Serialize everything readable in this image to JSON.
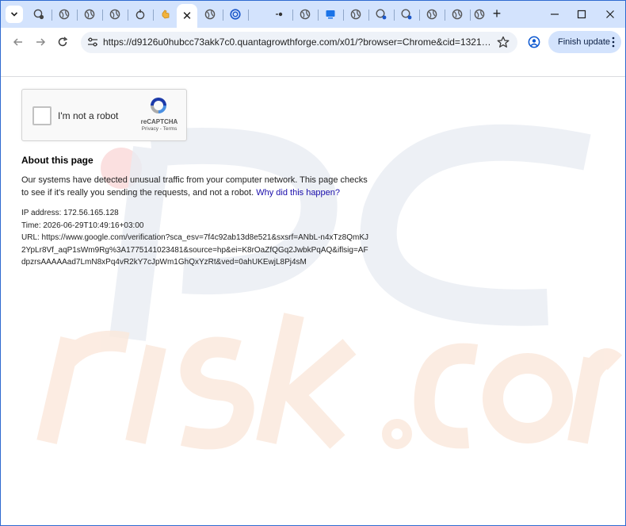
{
  "browser": {
    "tab_count_pinned": 21,
    "active_tab_close": "✕",
    "new_tab_label": "+",
    "address_url": "https://d9126u0hubcc73akk7c0.quantagrowthforge.com/x01/?browser=Chrome&cid=13212d8e9f...",
    "finish_update_label": "Finish update",
    "colors": {
      "tabstrip": "#d3e3fd",
      "accent": "#0b57d0"
    }
  },
  "captcha": {
    "label": "I'm not a robot",
    "brand": "reCAPTCHA",
    "privacy": "Privacy",
    "separator": " - ",
    "terms": "Terms"
  },
  "page": {
    "about_title": "About this page",
    "paragraph_text": "Our systems have detected unusual traffic from your computer network. This page checks to see if it's really you sending the requests, and not a robot. ",
    "paragraph_link": "Why did this happen?",
    "ip_line": "IP address: 172.56.165.128",
    "time_line": "Time: 2026-06-29T10:49:16+03:00",
    "url_line": "URL: https://www.google.com/verification?sca_esv=7f4c92ab13d8e521&sxsrf=ANbL-n4xTz8QmKJ2YpLr8Vf_aqP1sWm9Rg%3A1775141023481&source=hp&ei=K8rOaZfQGq2JwbkPqAQ&iflsig=AFdpzrsAAAAAad7LmN8xPq4vR2kY7cJpWm1GhQxYzRt&ved=0ahUKEwjL8Pj4sM"
  }
}
